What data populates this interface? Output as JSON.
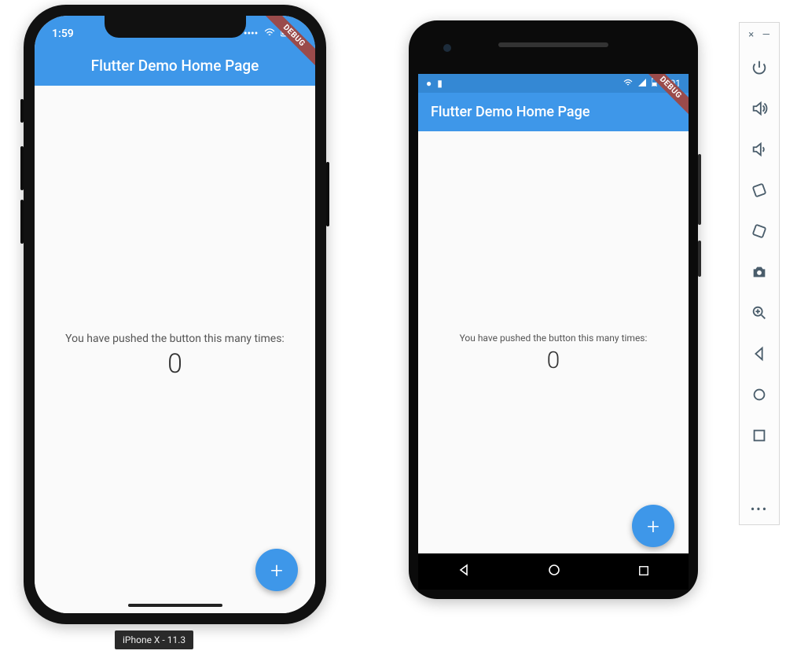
{
  "ios": {
    "status_time": "1:59",
    "status_icons": {
      "wifi": "wifi-icon",
      "battery": "battery-icon"
    },
    "appbar_title": "Flutter Demo Home Page",
    "body_text": "You have pushed the button this many times:",
    "counter": "0",
    "debug_banner": "DEBUG",
    "fab_label": "+",
    "device_label": "iPhone X - 11.3"
  },
  "android": {
    "status_time": "2:01",
    "status_icons_left": [
      "circle",
      "card"
    ],
    "status_icons_right": [
      "wifi",
      "signal",
      "battery"
    ],
    "appbar_title": "Flutter Demo Home Page",
    "body_text": "You have pushed the button this many times:",
    "counter": "0",
    "debug_banner": "DEBUG",
    "fab_label": "+",
    "nav": {
      "back": "◀",
      "home": "●",
      "recent": "■"
    }
  },
  "emulator_controls": {
    "close": "×",
    "minimize": "—",
    "items": [
      {
        "name": "power-icon"
      },
      {
        "name": "volume-up-icon"
      },
      {
        "name": "volume-down-icon"
      },
      {
        "name": "rotate-left-icon"
      },
      {
        "name": "rotate-right-icon"
      },
      {
        "name": "camera-icon"
      },
      {
        "name": "zoom-icon"
      },
      {
        "name": "back-icon"
      },
      {
        "name": "home-icon"
      },
      {
        "name": "overview-icon"
      }
    ],
    "more": "•••"
  },
  "colors": {
    "primary": "#3e97e9",
    "banner": "#9a4b4b"
  }
}
